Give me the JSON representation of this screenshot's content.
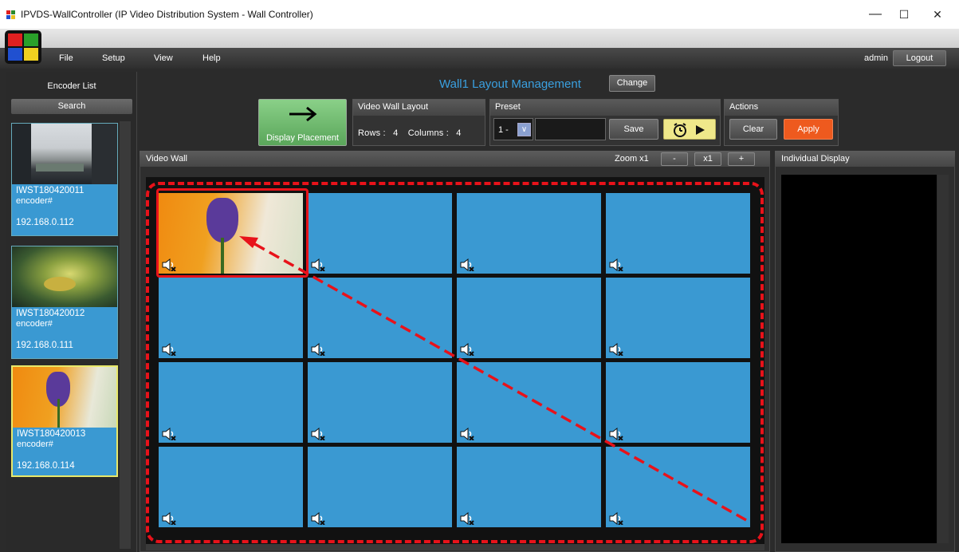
{
  "window": {
    "title": "IPVDS-WallController (IP Video Distribution System - Wall Controller)",
    "minimize": "—",
    "maximize": "☐",
    "close": "✕"
  },
  "menu": {
    "items": [
      "File",
      "Setup",
      "View",
      "Help"
    ],
    "user": "admin",
    "logout": "Logout"
  },
  "encoder_list": {
    "title": "Encoder List",
    "search": "Search",
    "encoders": [
      {
        "name": "IWST180420011",
        "type": "encoder#",
        "ip": "192.168.0.112",
        "selected": false
      },
      {
        "name": "IWST180420012",
        "type": "encoder#",
        "ip": "192.168.0.111",
        "selected": false
      },
      {
        "name": "IWST180420013",
        "type": "encoder#",
        "ip": "192.168.0.114",
        "selected": true
      }
    ]
  },
  "header": {
    "title": "Wall1 Layout Management",
    "change": "Change"
  },
  "display_placement": {
    "label": "Display Placement"
  },
  "video_wall_layout": {
    "title": "Video Wall Layout",
    "rows_label": "Rows :",
    "rows": "4",
    "columns_label": "Columns :",
    "columns": "4"
  },
  "preset": {
    "title": "Preset",
    "number": "1 -",
    "save": "Save"
  },
  "actions": {
    "title": "Actions",
    "clear": "Clear",
    "apply": "Apply"
  },
  "video_wall": {
    "title": "Video Wall",
    "zoom_label": "Zoom x1",
    "zoom_out": "-",
    "zoom_reset": "x1",
    "zoom_in": "+",
    "grid_rows": 4,
    "grid_cols": 4,
    "assigned_cells": [
      0
    ]
  },
  "individual_display": {
    "title": "Individual Display"
  },
  "colors": {
    "cell_blue": "#3a99d2",
    "annotation_red": "#e8121a",
    "apply_orange": "#ee5a1e",
    "display_green": "#5aa65a",
    "title_blue": "#3aa0e0"
  },
  "icons": [
    "app-icon",
    "logo-icon",
    "arrow-right-icon",
    "alarm-clock-icon",
    "play-icon",
    "speaker-mute-icon",
    "dropdown-icon"
  ]
}
